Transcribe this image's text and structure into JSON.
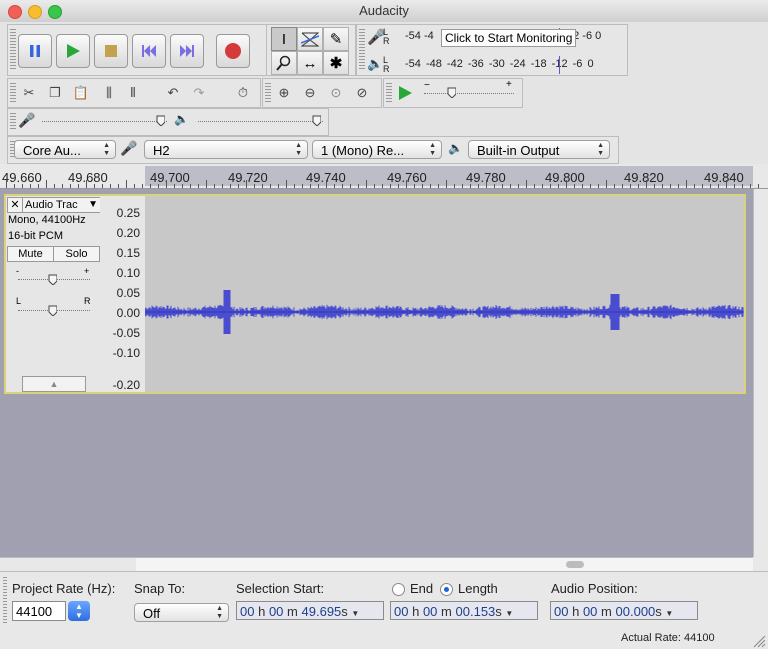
{
  "window": {
    "title": "Audacity"
  },
  "meters": {
    "record_ticks": "-54 -4",
    "record_ticks_right": "12  -6  0",
    "playback_ticks": "-54 -48 -42 -36 -30 -24 -18 -12  -6   0",
    "channel_left": "L",
    "channel_right": "R",
    "tooltip": "Click to Start Monitoring"
  },
  "devices": {
    "host": "Core Au...",
    "input_device": "H2",
    "channels": "1 (Mono) Re...",
    "output_device": "Built-in Output"
  },
  "ruler": {
    "labels": [
      "49.660",
      "49.680",
      "49.700",
      "49.720",
      "49.740",
      "49.760",
      "49.780",
      "49.800",
      "49.820",
      "49.840"
    ]
  },
  "track": {
    "name": "Audio Trac",
    "info_rate": "Mono, 44100Hz",
    "info_format": "16-bit PCM",
    "mute_label": "Mute",
    "solo_label": "Solo",
    "gain_minus": "-",
    "gain_plus": "+",
    "pan_left": "L",
    "pan_right": "R",
    "vruler": [
      "0.25",
      "0.20",
      "0.15",
      "0.10",
      "0.05",
      "0.00",
      "-0.05",
      "-0.10",
      "-0.20"
    ]
  },
  "selection_bar": {
    "project_rate_label": "Project Rate (Hz):",
    "project_rate_value": "44100",
    "snap_label": "Snap To:",
    "snap_value": "Off",
    "selection_start_label": "Selection Start:",
    "end_label": "End",
    "length_label": "Length",
    "audio_position_label": "Audio Position:",
    "selection_start": {
      "h": "00",
      "m": "00",
      "s": "49.695"
    },
    "length": {
      "h": "00",
      "m": "00",
      "s": "00.153"
    },
    "audio_position": {
      "h": "00",
      "m": "00",
      "s": "00.000"
    },
    "unit_h": "h",
    "unit_m": "m",
    "unit_s": "s"
  },
  "status": {
    "actual_rate": "Actual Rate: 44100"
  },
  "colors": {
    "waveform": "#3b3fd0",
    "track_border": "#d9d27a",
    "background": "#a0a0b0"
  }
}
